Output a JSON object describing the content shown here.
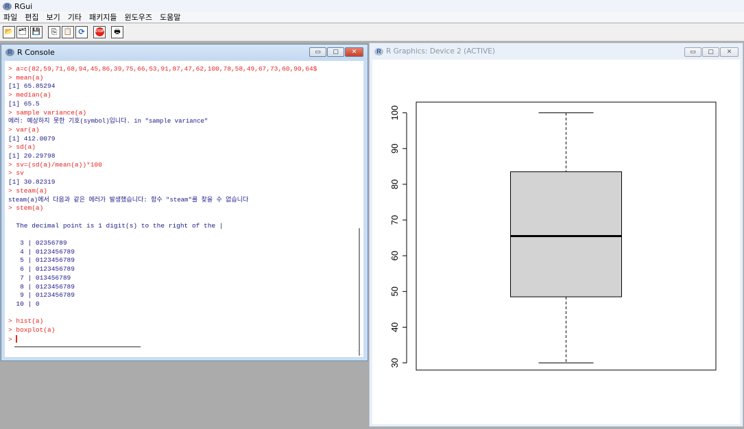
{
  "app": {
    "title": "RGui"
  },
  "menu": [
    "파일",
    "편집",
    "보기",
    "기타",
    "패키지들",
    "윈도우즈",
    "도움말"
  ],
  "toolbar": [
    {
      "icon": "open-script-icon",
      "glyph": "📂"
    },
    {
      "icon": "load-workspace-icon",
      "glyph": "🗂"
    },
    {
      "icon": "save-icon",
      "glyph": "💾"
    },
    {
      "icon": "copy-icon",
      "glyph": "⎘"
    },
    {
      "icon": "paste-icon",
      "glyph": "📋"
    },
    {
      "icon": "refresh-icon",
      "glyph": "⟳"
    },
    {
      "icon": "stop-icon",
      "glyph": "STOP"
    },
    {
      "icon": "print-icon",
      "glyph": "🖶"
    }
  ],
  "console": {
    "title": "R Console",
    "lines": [
      {
        "type": "cmd",
        "text": "> a=c(82,59,71,68,94,45,86,39,75,66,53,91,87,47,62,100,78,58,49,67,73,60,90,64$"
      },
      {
        "type": "cmd",
        "text": "> mean(a)"
      },
      {
        "type": "out",
        "text": "[1] 65.85294"
      },
      {
        "type": "cmd",
        "text": "> median(a)"
      },
      {
        "type": "out",
        "text": "[1] 65.5"
      },
      {
        "type": "cmd",
        "text": "> sample variance(a)"
      },
      {
        "type": "msg",
        "text": "에러: 예상하지 못한 기호(symbol)입니다. in \"sample variance\""
      },
      {
        "type": "cmd",
        "text": "> var(a)"
      },
      {
        "type": "out",
        "text": "[1] 412.0079"
      },
      {
        "type": "cmd",
        "text": "> sd(a)"
      },
      {
        "type": "out",
        "text": "[1] 20.29798"
      },
      {
        "type": "cmd",
        "text": "> sv=(sd(a)/mean(a))*100"
      },
      {
        "type": "cmd",
        "text": "> sv"
      },
      {
        "type": "out",
        "text": "[1] 30.82319"
      },
      {
        "type": "cmd",
        "text": "> steam(a)"
      },
      {
        "type": "msg",
        "text": "steam(a)에서 다음과 같은 에러가 발생했습니다: 함수 \"steam\"를 찾을 수 없습니다"
      },
      {
        "type": "cmd",
        "text": "> stem(a)"
      },
      {
        "type": "out",
        "text": ""
      },
      {
        "type": "out",
        "text": "  The decimal point is 1 digit(s) to the right of the |"
      },
      {
        "type": "out",
        "text": ""
      },
      {
        "type": "out",
        "text": "   3 | 02356789"
      },
      {
        "type": "out",
        "text": "   4 | 0123456789"
      },
      {
        "type": "out",
        "text": "   5 | 0123456789"
      },
      {
        "type": "out",
        "text": "   6 | 0123456789"
      },
      {
        "type": "out",
        "text": "   7 | 013456789"
      },
      {
        "type": "out",
        "text": "   8 | 0123456789"
      },
      {
        "type": "out",
        "text": "   9 | 0123456789"
      },
      {
        "type": "out",
        "text": "  10 | 0"
      },
      {
        "type": "out",
        "text": ""
      },
      {
        "type": "cmd",
        "text": "> hist(a)"
      },
      {
        "type": "cmd",
        "text": "> boxplot(a)"
      }
    ],
    "prompt": "> "
  },
  "graphics": {
    "title": "R Graphics: Device 2 (ACTIVE)"
  },
  "window_buttons": {
    "minimize": "▭",
    "maximize": "▢",
    "close": "✕"
  },
  "chart_data": {
    "type": "box",
    "title": "",
    "xlabel": "",
    "ylabel": "",
    "ylim": [
      28,
      103
    ],
    "yticks": [
      30,
      40,
      50,
      60,
      70,
      80,
      90,
      100
    ],
    "min": 30,
    "q1": 48.5,
    "median": 65.5,
    "q3": 83.5,
    "max": 100,
    "box_fill": "#d3d3d3"
  }
}
